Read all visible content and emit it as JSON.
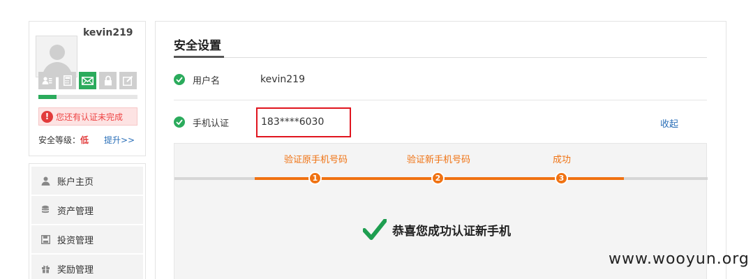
{
  "profile": {
    "username": "kevin219",
    "cert_icons": [
      {
        "name": "id-card-icon",
        "active": false
      },
      {
        "name": "calculator-icon",
        "active": false
      },
      {
        "name": "mail-icon",
        "active": true
      },
      {
        "name": "lock-icon",
        "active": false
      },
      {
        "name": "edit-icon",
        "active": false
      }
    ],
    "progress": 0.18,
    "alert_text": "您还有认证未完成",
    "level_label": "安全等级：",
    "level_value": "低",
    "upgrade_link": "提升>>"
  },
  "menu": {
    "items": [
      {
        "label": "账户主页",
        "icon": "user-icon"
      },
      {
        "label": "资产管理",
        "icon": "coins-icon"
      },
      {
        "label": "投资管理",
        "icon": "save-icon"
      },
      {
        "label": "奖励管理",
        "icon": "gift-icon"
      }
    ]
  },
  "main": {
    "title": "安全设置",
    "username_row": {
      "label": "用户名",
      "value": "kevin219"
    },
    "phone_row": {
      "label": "手机认证",
      "value": "183****6030",
      "action": "收起"
    },
    "steps": [
      {
        "number": "1",
        "label": "验证原手机号码"
      },
      {
        "number": "2",
        "label": "验证新手机号码"
      },
      {
        "number": "3",
        "label": "成功"
      }
    ],
    "success_message": "恭喜您成功认证新手机"
  },
  "watermark": "www.wooyun.org",
  "colors": {
    "accent_green": "#2bab5c",
    "accent_orange": "#f07212",
    "alert_red": "#e23b3b",
    "link_blue": "#2a6fb8"
  }
}
